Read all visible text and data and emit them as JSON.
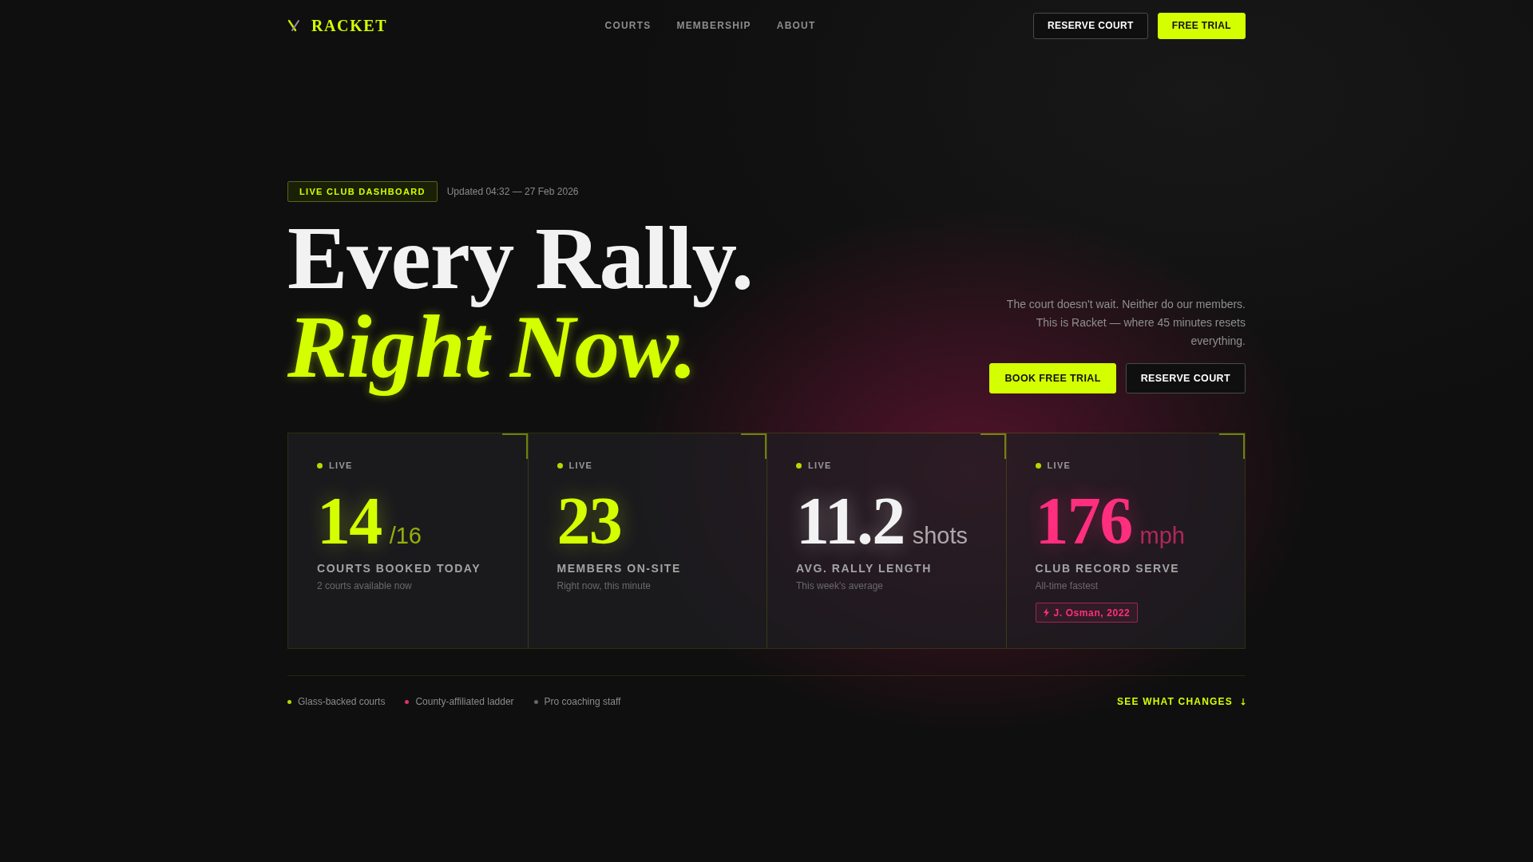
{
  "nav": {
    "logo": "RACKET",
    "links": [
      {
        "label": "COURTS"
      },
      {
        "label": "MEMBERSHIP"
      },
      {
        "label": "ABOUT"
      }
    ],
    "buttons": [
      {
        "label": "RESERVE COURT",
        "kind": "outline"
      },
      {
        "label": "FREE TRIAL",
        "kind": "primary"
      }
    ]
  },
  "hero": {
    "badge": "LIVE CLUB DASHBOARD",
    "updated": "Updated 04:32 — 27 Feb 2026",
    "headline": "Every Rally.",
    "headline_accent": "Right Now.",
    "description": "The court doesn't wait. Neither do our members. This is Racket — where 45 minutes resets everything.",
    "buttons": [
      {
        "label": "BOOK FREE TRIAL",
        "kind": "primary"
      },
      {
        "label": "RESERVE COURT",
        "kind": "outline"
      }
    ]
  },
  "stats": [
    {
      "status": "LIVE",
      "value": "14",
      "unit": "/16",
      "label": "COURTS BOOKED TODAY",
      "note": "2 courts available now",
      "color": "#d4ff00"
    },
    {
      "status": "LIVE",
      "value": "23",
      "label": "MEMBERS ON-SITE",
      "note": "Right now, this minute",
      "color": "#d4ff00"
    },
    {
      "status": "LIVE",
      "value": "11.2",
      "unit": "shots",
      "label": "AVG. RALLY LENGTH",
      "note": "This week's average",
      "color": "#f2f2f2"
    },
    {
      "status": "LIVE",
      "value": "176",
      "unit": "mph",
      "label": "CLUB RECORD SERVE",
      "note": "All-time fastest",
      "color": "#ff2e7e",
      "record": "J. Osman, 2022"
    }
  ],
  "footer": {
    "features": [
      {
        "label": "Glass-backed courts",
        "color": "#b8d800"
      },
      {
        "label": "County-affiliated ladder",
        "color": "#e0306a"
      },
      {
        "label": "Pro coaching staff",
        "color": "#666666"
      }
    ],
    "link": "SEE WHAT CHANGES"
  }
}
